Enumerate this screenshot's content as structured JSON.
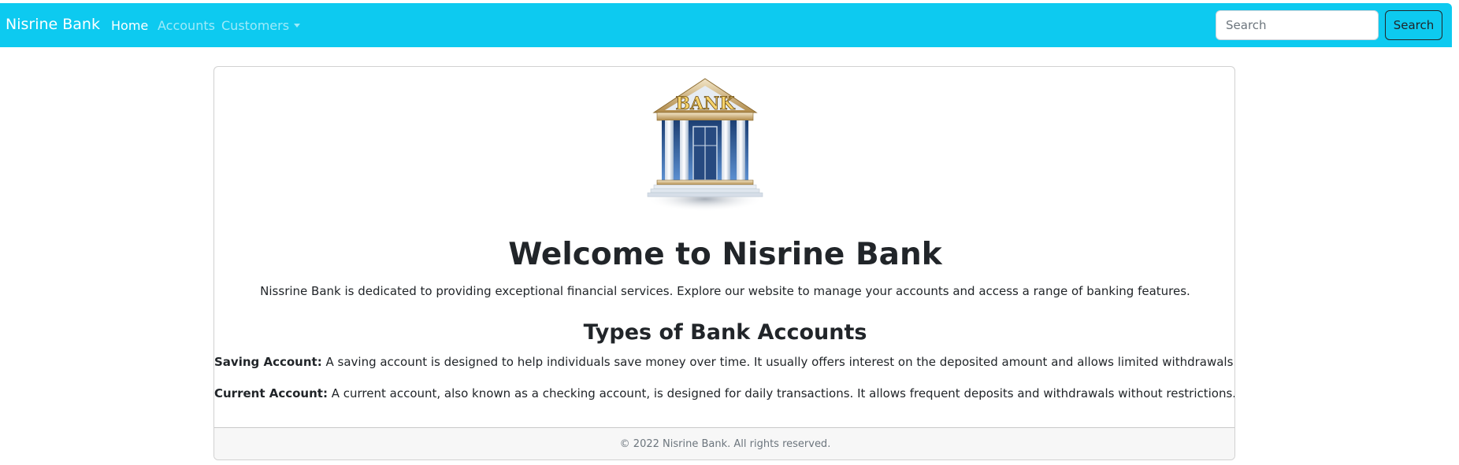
{
  "navbar": {
    "brand": "Nisrine Bank",
    "links": [
      {
        "label": "Home",
        "active": true
      },
      {
        "label": "Accounts",
        "active": false
      },
      {
        "label": "Customers",
        "active": false
      }
    ],
    "search": {
      "placeholder": "Search",
      "value": "",
      "button_label": "Search"
    },
    "color": "#0dcaf0"
  },
  "hero": {
    "logo_icon": "bank-building-icon",
    "logo_text": "BANK",
    "title": "Welcome to Nisrine Bank",
    "intro": "Nissrine Bank is dedicated to providing exceptional financial services. Explore our website to manage your accounts and access a range of banking features."
  },
  "types": {
    "title": "Types of Bank Accounts",
    "items": [
      {
        "name": "Saving Account:",
        "description": " A saving account is designed to help individuals save money over time. It usually offers interest on the deposited amount and allows limited withdrawals."
      },
      {
        "name": "Current Account:",
        "description": " A current account, also known as a checking account, is designed for daily transactions. It allows frequent deposits and withdrawals without restrictions."
      }
    ]
  },
  "footer": {
    "text": "© 2022 Nisrine Bank. All rights reserved."
  }
}
